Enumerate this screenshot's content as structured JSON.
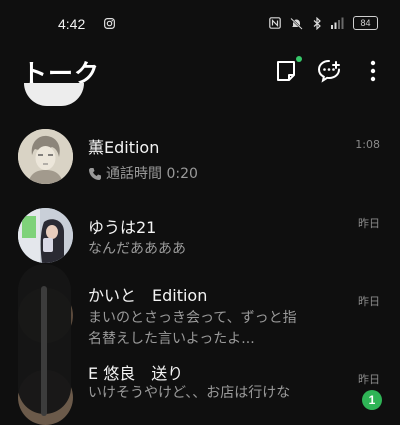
{
  "status_bar": {
    "time": "4:42",
    "battery": "84",
    "icons": [
      "instagram-icon",
      "nfc-icon",
      "mute-icon",
      "bluetooth-icon",
      "signal-icon",
      "battery-icon"
    ]
  },
  "header": {
    "title": "トーク",
    "icons": [
      "notes-icon",
      "new-chat-icon",
      "more-vert-icon"
    ],
    "notification_dot_color": "#36c769"
  },
  "chats": [
    {
      "name": "薫Edition",
      "preview": "通話時間 0:20",
      "preview_icon": "phone-icon",
      "time": "1:08"
    },
    {
      "name": "ゆうは21",
      "preview": "なんだああああ",
      "time": "昨日"
    },
    {
      "name": "かいと　Edition",
      "preview_line1": "まいのとさっき会って、ずっと指",
      "preview_line2": "名替えした言いよったよ...",
      "time": "昨日"
    },
    {
      "name": "E 悠良　送り",
      "preview": "いけそうやけど、、お店は行けな",
      "time": "昨日",
      "unread": "1"
    }
  ],
  "colors": {
    "background": "#0f0f0f",
    "unread_badge": "#2fb456",
    "secondary_text": "#9a9a9a"
  }
}
